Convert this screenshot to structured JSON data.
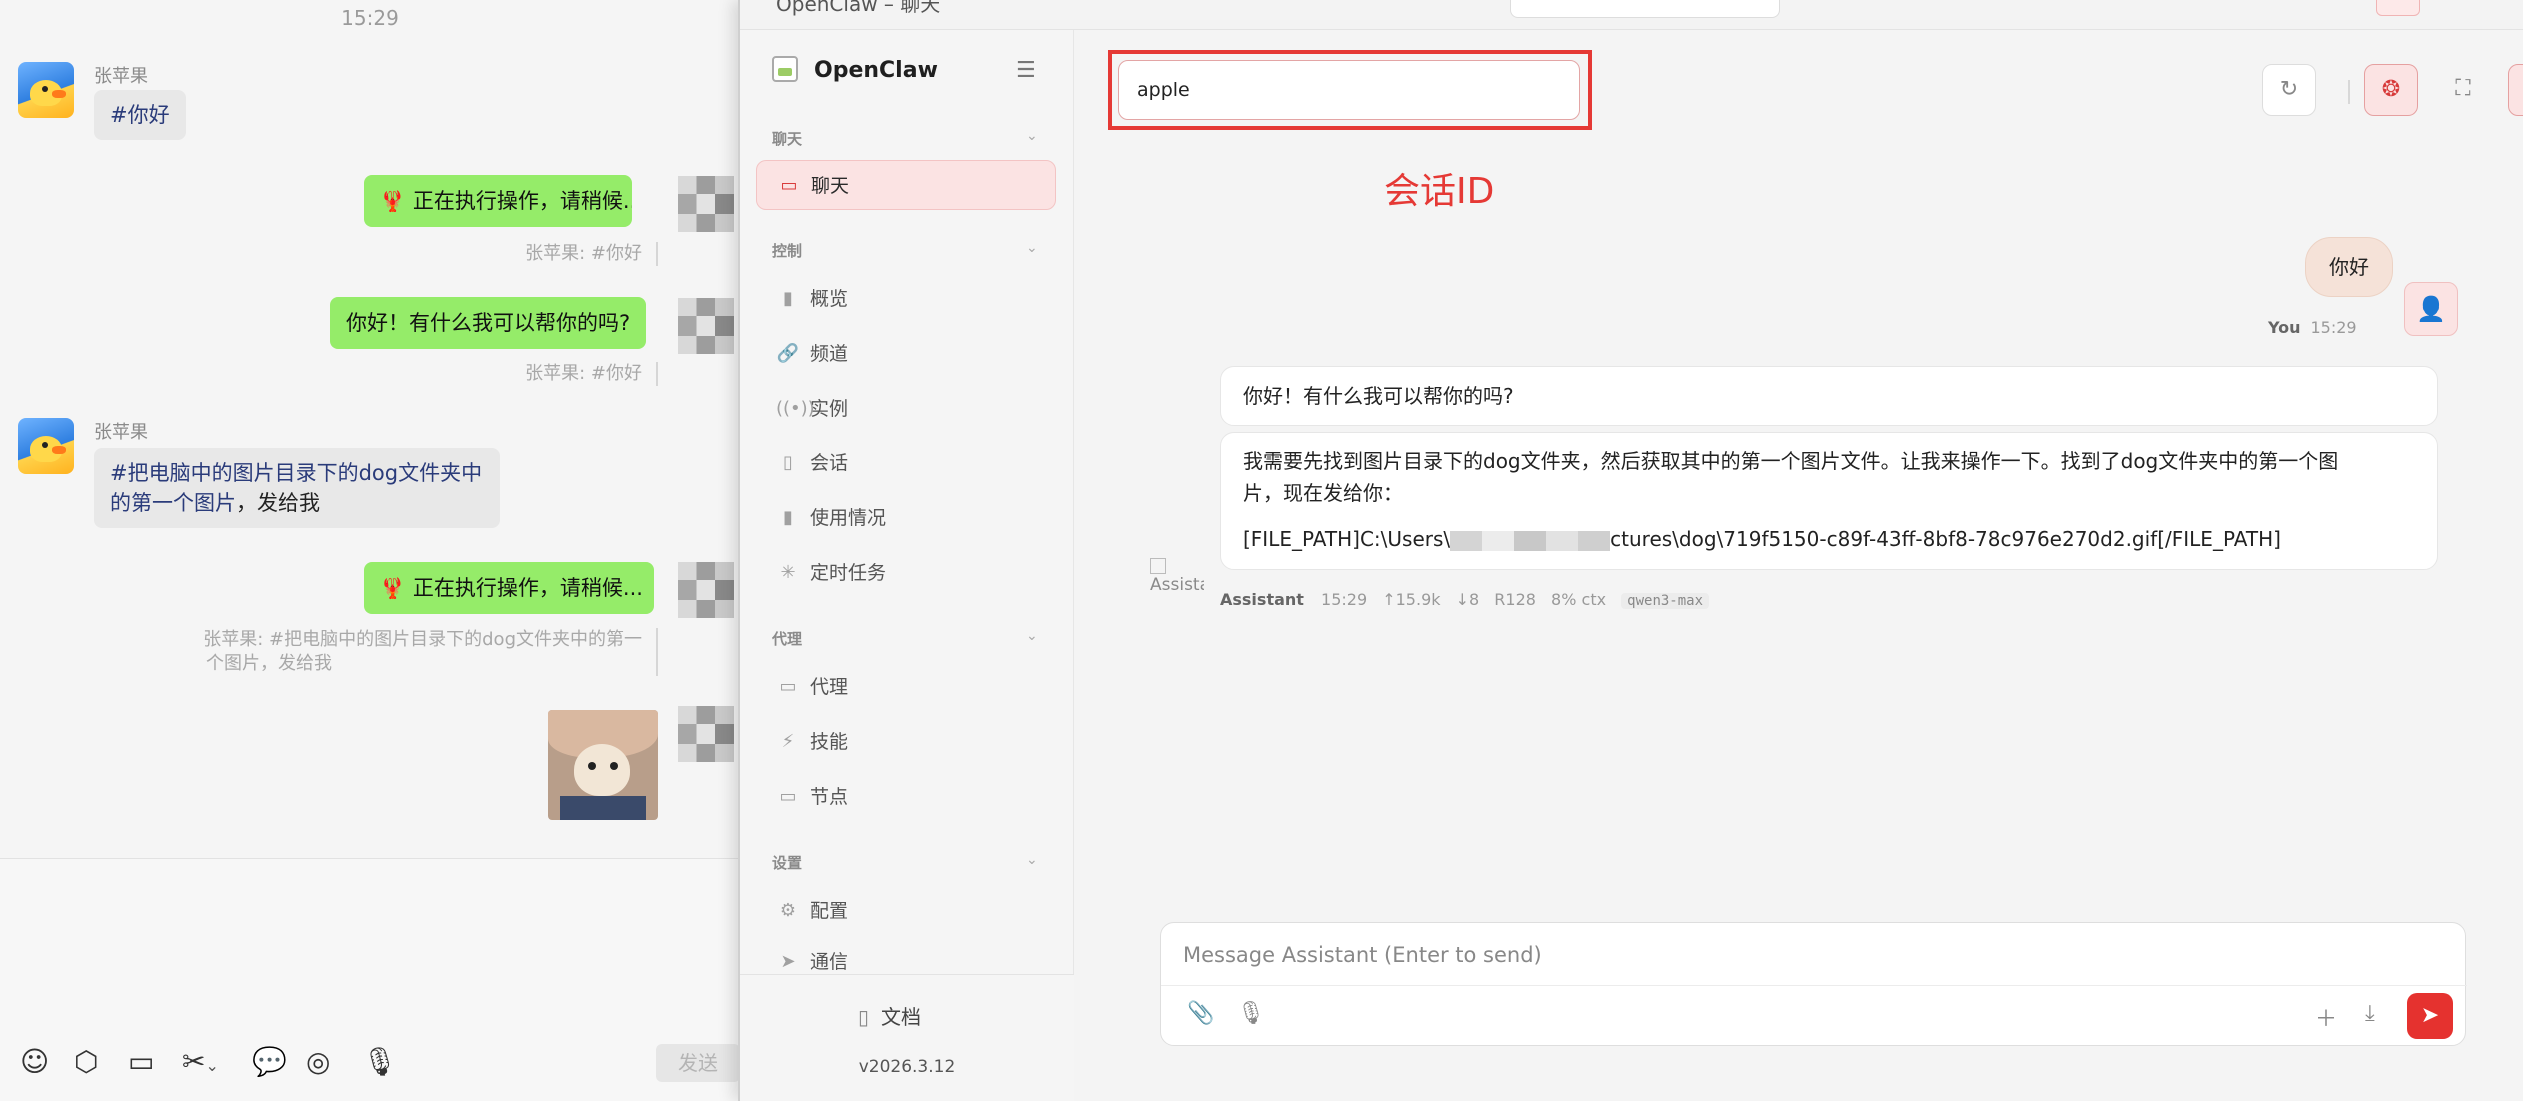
{
  "chat": {
    "timestamp": "15:29",
    "contact_name": "张苹果",
    "msg1": "#你好",
    "msg2": "正在执行操作，请稍候...",
    "quote2": "张苹果: #你好",
    "msg3": "你好！有什么我可以帮你的吗?",
    "quote3": "张苹果: #你好",
    "msg4_line1": "#把电脑中的图片目录下的dog文件夹中",
    "msg4_line2_a": "的第一个图片",
    "msg4_line2_b": "，发给我",
    "msg5": "正在执行操作，请稍候...",
    "quote5_line1": "张苹果: #把电脑中的图片目录下的dog文件夹中的第一",
    "quote5_line2": "个图片，发给我",
    "send_label": "发送",
    "bubble_color": "#95ec69"
  },
  "app": {
    "title": "OpenClaw – 聊天",
    "brand": "OpenClaw",
    "sections": {
      "chat": "聊天",
      "control": "控制",
      "agent": "代理",
      "settings": "设置"
    },
    "nav": {
      "chat": "聊天",
      "overview": "概览",
      "channels": "频道",
      "instances": "实例",
      "sessions": "会话",
      "usage": "使用情况",
      "cron": "定时任务",
      "agents": "代理",
      "skills": "技能",
      "nodes": "节点",
      "config": "配置",
      "comms": "通信"
    },
    "docs": "文档",
    "version": "v2026.3.12",
    "accent_color": "#e5322f"
  },
  "session": {
    "id_value": "apple",
    "annotation": "会话ID"
  },
  "conversation": {
    "user_text": "你好",
    "user_name": "You",
    "user_time": "15:29",
    "assistant_reply1": "你好！有什么我可以帮你的吗?",
    "assistant_reply2_line1": "我需要先找到图片目录下的dog文件夹，然后获取其中的第一个图片文件。让我来操作一下。找到了dog文件夹中的第一个图",
    "assistant_reply2_line2": "片，现在发给你：",
    "filepath_prefix": "[FILE_PATH]C:\\Users\\",
    "filepath_suffix": "ctures\\dog\\719f5150-c89f-43ff-8bf8-78c976e270d2.gif[/FILE_PATH]",
    "assistant_avatar_alt": "Assistant",
    "assistant_name": "Assistant",
    "assistant_time": "15:29",
    "stat_in": "↑15.9k",
    "stat_out": "↓8",
    "stat_r": "R128",
    "stat_ctx": "8% ctx",
    "model": "qwen3-max"
  },
  "composer": {
    "placeholder": "Message Assistant (Enter to send)"
  }
}
